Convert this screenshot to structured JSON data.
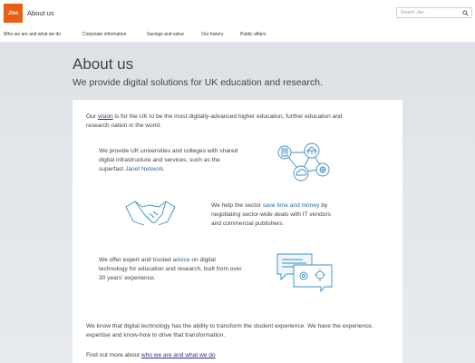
{
  "header": {
    "logo_text": "Jisc",
    "title": "About us",
    "search_placeholder": "Search Jisc",
    "brand_color": "#e85e13"
  },
  "nav": {
    "items": [
      "Who we are and what we do",
      "Corporate information",
      "Savings and value",
      "Our history",
      "Public affairs"
    ]
  },
  "hero": {
    "title": "About us",
    "subtitle": "We provide digital solutions for UK education and research."
  },
  "content": {
    "intro_prefix": "Our ",
    "intro_link": "vision",
    "intro_suffix": " is for the UK to be the most digitally-advanced higher education, further education and research nation in the world.",
    "block1_text": "We provide UK universities and colleges with shared digital infrastructure and services, such as the superfast ",
    "block1_link": "Janet Network",
    "block1_end": ".",
    "block2_prefix": "We help the sector ",
    "block2_link": "save time and money",
    "block2_suffix": " by negotiating sector-wide deals with IT vendors and commercial publishers.",
    "block3_prefix": "We offer expert and trusted ",
    "block3_link": "advice",
    "block3_suffix": " on digital technology for education and research, built from over 30 years' experience.",
    "closing": "We know that digital technology has the ability to transform the student experience. We have the experience, expertise and know-how to drive that transformation.",
    "findout_prefix": "Find out more about ",
    "findout_link": "who we are and what we do"
  },
  "icons": {
    "search": "search-icon",
    "network": "network-icon",
    "handshake": "handshake-icon",
    "advice": "advice-icon"
  },
  "colors": {
    "link": "#2a6aa8",
    "illustration": "#3b8fc4"
  }
}
